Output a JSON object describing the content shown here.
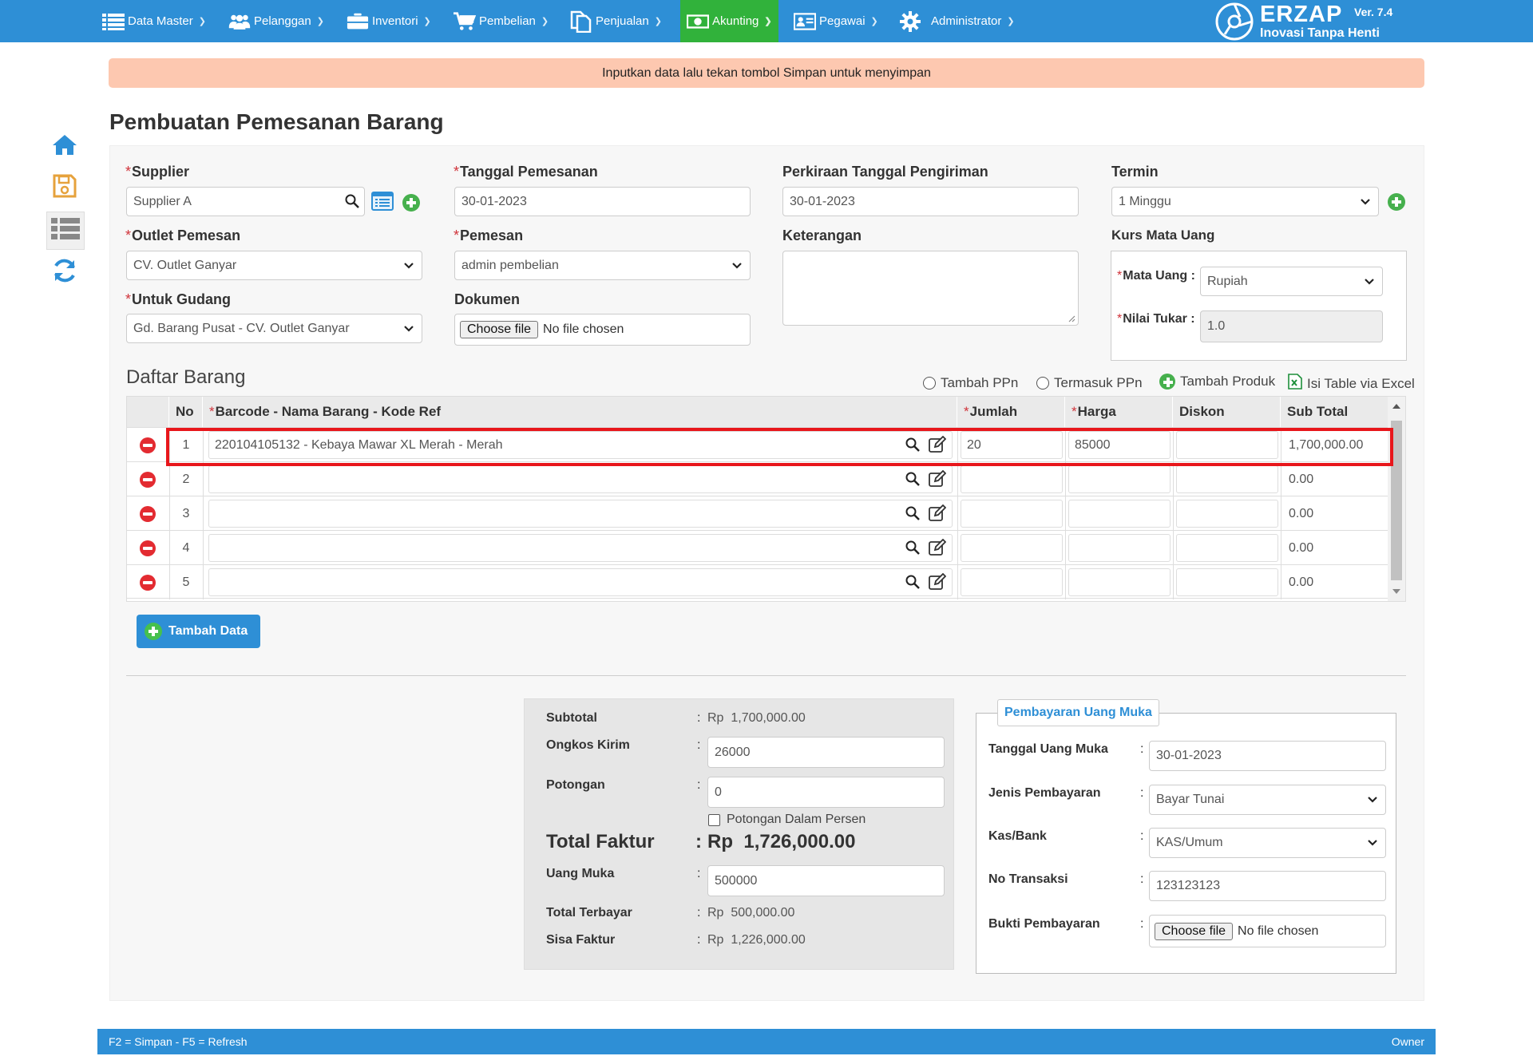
{
  "nav": {
    "items": [
      {
        "label": "Data Master",
        "icon": "list-icon"
      },
      {
        "label": "Pelanggan",
        "icon": "users-icon"
      },
      {
        "label": "Inventori",
        "icon": "briefcase-icon"
      },
      {
        "label": "Pembelian",
        "icon": "cart-icon"
      },
      {
        "label": "Penjualan",
        "icon": "documents-icon"
      },
      {
        "label": "Akunting",
        "icon": "money-icon",
        "active": true
      },
      {
        "label": "Pegawai",
        "icon": "id-card-icon"
      },
      {
        "label": "Administrator",
        "icon": "gear-icon"
      }
    ],
    "brand": {
      "name": "ERZAP",
      "tagline": "Inovasi Tanpa Henti",
      "version": "Ver. 7.4"
    }
  },
  "alert": "Inputkan data lalu tekan tombol Simpan untuk menyimpan",
  "page_title": "Pembuatan Pemesanan Barang",
  "form": {
    "supplier": {
      "label": "Supplier",
      "value": "Supplier A"
    },
    "tanggal_pemesanan": {
      "label": "Tanggal Pemesanan",
      "value": "30-01-2023"
    },
    "perkiraan_pengiriman": {
      "label": "Perkiraan Tanggal Pengiriman",
      "value": "30-01-2023"
    },
    "termin": {
      "label": "Termin",
      "value": "1 Minggu"
    },
    "outlet_pemesan": {
      "label": "Outlet Pemesan",
      "value": "CV. Outlet Ganyar"
    },
    "pemesan": {
      "label": "Pemesan",
      "value": "admin pembelian"
    },
    "keterangan": {
      "label": "Keterangan",
      "value": ""
    },
    "kurs": {
      "label": "Kurs Mata Uang",
      "mata_uang_label": "Mata Uang :",
      "mata_uang": "Rupiah",
      "nilai_tukar_label": "Nilai Tukar :",
      "nilai_tukar": "1.0"
    },
    "untuk_gudang": {
      "label": "Untuk Gudang",
      "value": "Gd. Barang Pusat - CV. Outlet Ganyar"
    },
    "dokumen": {
      "label": "Dokumen",
      "button": "Choose file",
      "status": "No file chosen"
    }
  },
  "items_section": {
    "title": "Daftar Barang",
    "options": {
      "tambah_ppn": "Tambah PPn",
      "termasuk_ppn": "Termasuk PPn",
      "tambah_produk": "Tambah Produk",
      "isi_excel": "Isi Table via Excel"
    },
    "columns": {
      "no": "No",
      "barang": "Barcode - Nama Barang - Kode Ref",
      "jumlah": "Jumlah",
      "harga": "Harga",
      "diskon": "Diskon",
      "subtotal": "Sub Total"
    },
    "rows": [
      {
        "no": "1",
        "barang": "220104105132 - Kebaya Mawar XL Merah - Merah",
        "jumlah": "20",
        "harga": "85000",
        "diskon": "",
        "subtotal": "1,700,000.00"
      },
      {
        "no": "2",
        "barang": "",
        "jumlah": "",
        "harga": "",
        "diskon": "",
        "subtotal": "0.00"
      },
      {
        "no": "3",
        "barang": "",
        "jumlah": "",
        "harga": "",
        "diskon": "",
        "subtotal": "0.00"
      },
      {
        "no": "4",
        "barang": "",
        "jumlah": "",
        "harga": "",
        "diskon": "",
        "subtotal": "0.00"
      },
      {
        "no": "5",
        "barang": "",
        "jumlah": "",
        "harga": "",
        "diskon": "",
        "subtotal": "0.00"
      }
    ],
    "add_button": "Tambah Data"
  },
  "summary": {
    "colon": ":",
    "currency": "Rp",
    "subtotal_label": "Subtotal",
    "subtotal": "1,700,000.00",
    "ongkos_label": "Ongkos Kirim",
    "ongkos": "26000",
    "potongan_label": "Potongan",
    "potongan": "0",
    "potongan_persen": "Potongan Dalam Persen",
    "total_label": "Total Faktur",
    "total": "1,726,000.00",
    "uang_muka_label": "Uang Muka",
    "uang_muka": "500000",
    "terbayar_label": "Total Terbayar",
    "terbayar": "500,000.00",
    "sisa_label": "Sisa Faktur",
    "sisa": "1,226,000.00"
  },
  "payment": {
    "title": "Pembayaran Uang Muka",
    "tanggal_label": "Tanggal Uang Muka",
    "tanggal": "30-01-2023",
    "jenis_label": "Jenis Pembayaran",
    "jenis": "Bayar Tunai",
    "kas_label": "Kas/Bank",
    "kas": "KAS/Umum",
    "no_label": "No Transaksi",
    "no": "123123123",
    "bukti_label": "Bukti Pembayaran",
    "bukti_button": "Choose file",
    "bukti_status": "No file chosen"
  },
  "footer": {
    "shortcuts": "F2 = Simpan - F5 = Refresh",
    "user": "Owner"
  },
  "colors": {
    "primary": "#2e8fd6",
    "active_nav": "#31b23b",
    "alert_bg": "#fdc8b0",
    "required": "#d0333a",
    "delete": "#e32b31",
    "highlight": "#e8161b"
  }
}
